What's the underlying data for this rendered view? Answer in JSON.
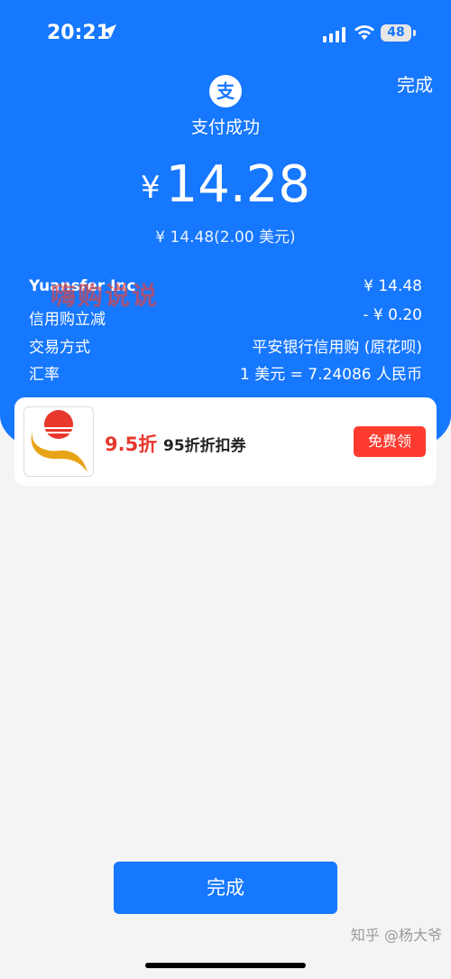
{
  "status_bar": {
    "time": "20:21",
    "battery": "48",
    "icons": [
      "location-arrow-icon",
      "cellular-signal-icon",
      "wifi-icon",
      "battery-icon"
    ]
  },
  "header": {
    "done_label": "完成",
    "logo_char": "支",
    "success_text": "支付成功"
  },
  "payment": {
    "currency_symbol": "¥",
    "amount": "14.28",
    "original_amount": "¥ 14.48(2.00 美元)"
  },
  "details": [
    {
      "label": "Yuansfer Inc",
      "value": "¥ 14.48"
    },
    {
      "label": "信用购立减",
      "value": "- ¥ 0.20"
    },
    {
      "label": "交易方式",
      "value": "平安银行信用购 (原花呗)"
    },
    {
      "label": "汇率",
      "value": "1 美元 = 7.24086 人民币"
    }
  ],
  "watermark_text": "嗨购说说",
  "coupon": {
    "discount": "9.5折",
    "description": "95折折扣券",
    "claim_label": "免费领"
  },
  "bottom": {
    "done_label": "完成",
    "zhihu_watermark": "知乎 @杨大爷"
  },
  "colors": {
    "primary_blue": "#1677ff",
    "coupon_red": "#e8372c",
    "claim_button": "#ff3b30"
  }
}
